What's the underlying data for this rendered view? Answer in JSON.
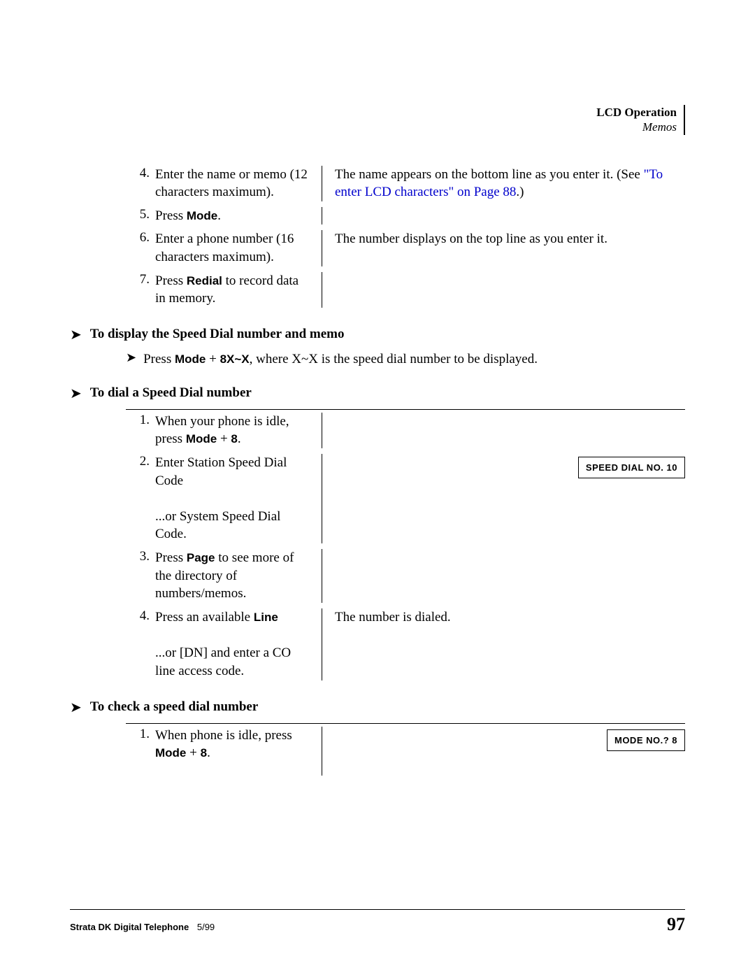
{
  "header": {
    "title": "LCD Operation",
    "subtitle": "Memos"
  },
  "steps_top": [
    {
      "num": "4.",
      "left_pre": "Enter the name or memo (12 characters maximum).",
      "right_pre": "The name appears on the bottom line as you enter it. (See ",
      "right_link": "\"To enter LCD characters\" on Page 88",
      "right_post": ".)"
    },
    {
      "num": "5.",
      "left_a": "Press ",
      "left_bold": "Mode",
      "left_b": ".",
      "right": ""
    },
    {
      "num": "6.",
      "left": "Enter a phone number (16 characters maximum).",
      "right": "The number displays on the top line as you enter it."
    },
    {
      "num": "7.",
      "left_a": "Press ",
      "left_bold": "Redial",
      "left_b": " to record data in memory.",
      "right": ""
    }
  ],
  "section_display": {
    "heading": "To display the Speed Dial number and memo",
    "bullet_a": "Press ",
    "bullet_bold1": "Mode",
    "bullet_mid": " + ",
    "bullet_bold2": "8X~X",
    "bullet_b": ", where X~X is the speed dial number to be displayed."
  },
  "section_dial": {
    "heading": "To dial a Speed Dial number",
    "steps": [
      {
        "num": "1.",
        "left_a": "When your phone is idle, press ",
        "left_bold1": "Mode",
        "left_mid": " + ",
        "left_bold2": "8",
        "left_b": ".",
        "right": ""
      },
      {
        "num": "2.",
        "left_line1": "Enter Station Speed Dial Code",
        "left_line2": "...or System Speed Dial Code.",
        "right_lcd": "SPEED DIAL NO. 10"
      },
      {
        "num": "3.",
        "left_a": "Press ",
        "left_bold": "Page",
        "left_b": " to see more of the directory of numbers/memos.",
        "right": ""
      },
      {
        "num": "4.",
        "left_a": "Press an available ",
        "left_bold": "Line",
        "left_line2": "...or [DN] and enter a CO line access code.",
        "right": "The number is dialed."
      }
    ]
  },
  "section_check": {
    "heading": "To check a speed dial number",
    "steps": [
      {
        "num": "1.",
        "left_a": "When phone is idle, press ",
        "left_bold1": "Mode",
        "left_mid": " + ",
        "left_bold2": "8",
        "left_b": ".",
        "right_lcd": "MODE NO.? 8"
      }
    ]
  },
  "footer": {
    "product": "Strata DK Digital Telephone",
    "date": "5/99",
    "page": "97"
  }
}
